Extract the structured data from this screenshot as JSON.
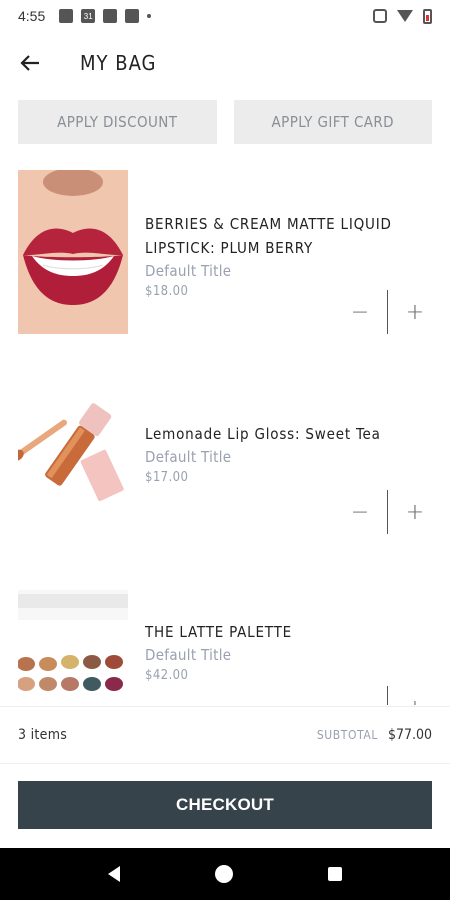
{
  "status": {
    "time": "4:55",
    "calendar_day": "31"
  },
  "header": {
    "title": "MY BAG"
  },
  "actions": {
    "discount_label": "APPLY DISCOUNT",
    "giftcard_label": "APPLY GIFT CARD"
  },
  "items": [
    {
      "name": "BERRIES & CREAM MATTE LIQUID LIPSTICK: PLUM BERRY",
      "variant": "Default Title",
      "price": "$18.00",
      "image_icon": "lipstick-lips-image"
    },
    {
      "name": "Lemonade Lip Gloss: Sweet Tea",
      "variant": "Default Title",
      "price": "$17.00",
      "image_icon": "lip-gloss-image"
    },
    {
      "name": "THE LATTE PALETTE",
      "variant": "Default Title",
      "price": "$42.00",
      "image_icon": "eyeshadow-palette-image"
    }
  ],
  "stepper": {
    "minus": "−",
    "plus": "+"
  },
  "summary": {
    "count": "3 items",
    "subtotal_label": "SUBTOTAL",
    "subtotal_value": "$77.00"
  },
  "checkout": {
    "label": "CHECKOUT"
  },
  "colors": {
    "checkout_bg": "#37434a",
    "muted_text": "#9aa0b0",
    "button_bg": "#ececec"
  }
}
